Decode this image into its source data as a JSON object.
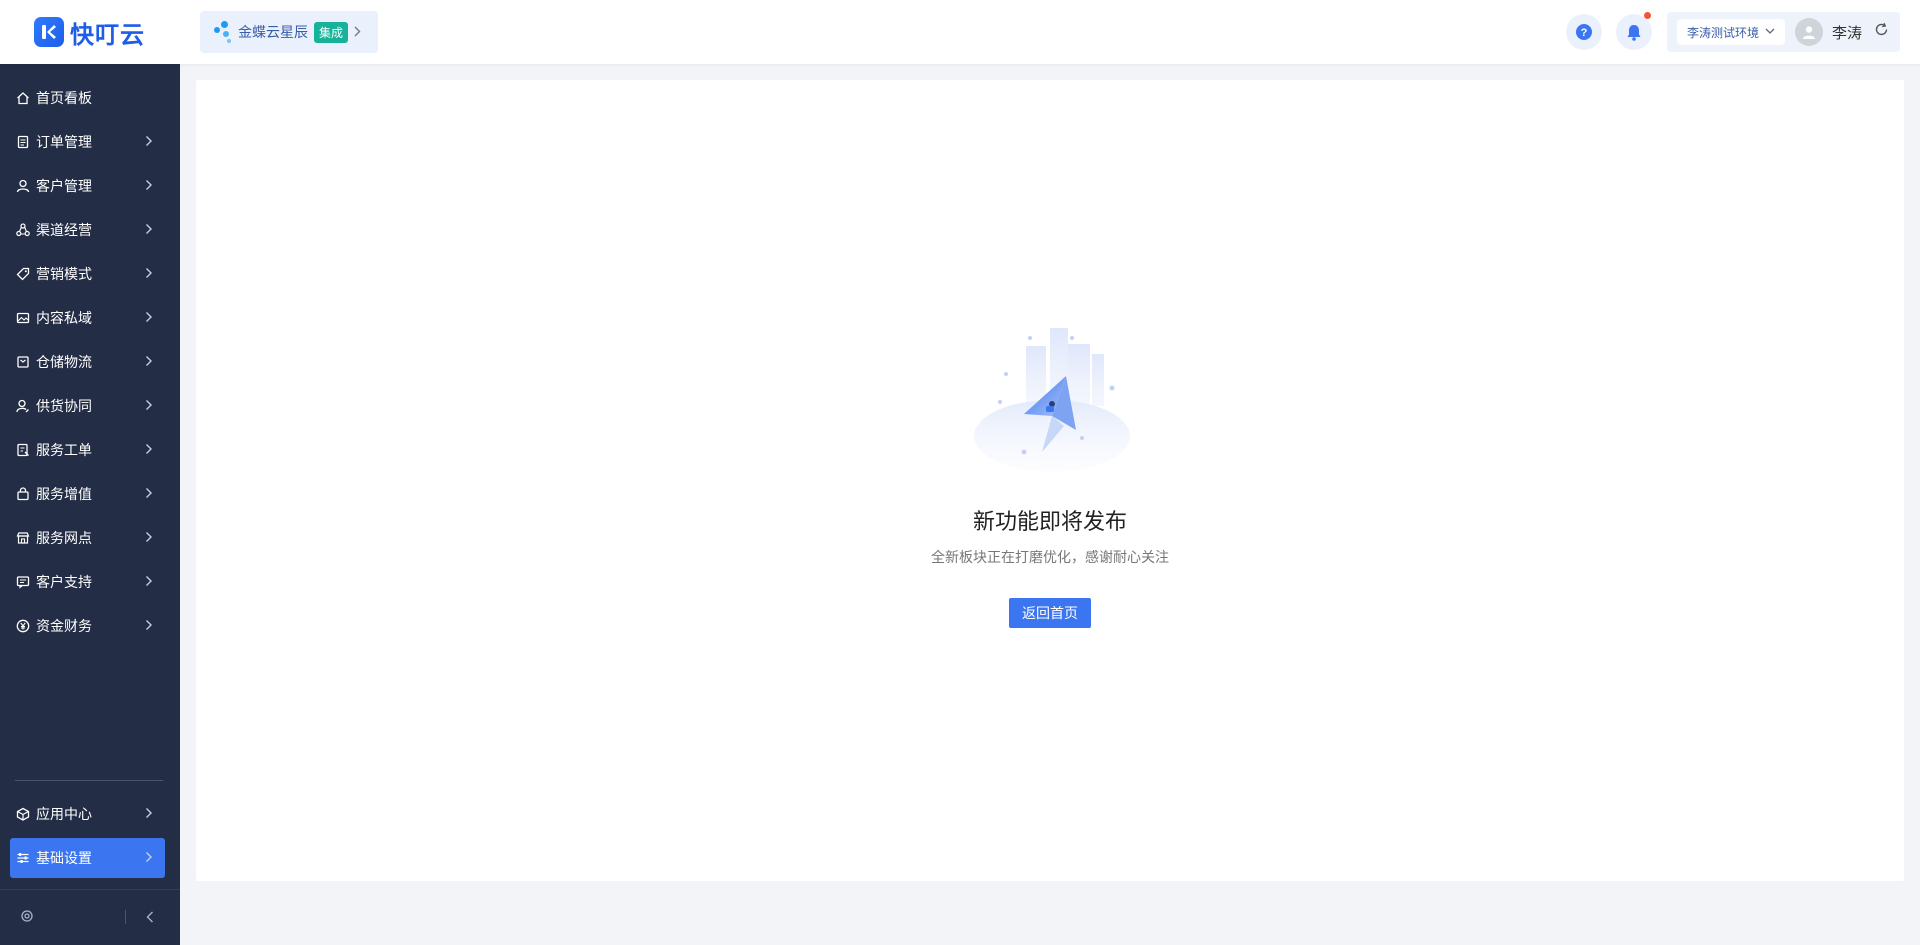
{
  "header": {
    "logo_text": "快叮云",
    "integration": {
      "label": "金蝶云星辰",
      "badge": "集成"
    },
    "help_icon": "question-circle-icon",
    "notification_icon": "bell-icon",
    "environment": "李涛测试环境",
    "username": "李涛"
  },
  "sidebar": {
    "items": [
      {
        "label": "首页看板",
        "icon": "home-icon"
      },
      {
        "label": "订单管理",
        "icon": "clipboard-icon"
      },
      {
        "label": "客户管理",
        "icon": "user-icon"
      },
      {
        "label": "渠道经营",
        "icon": "channel-icon"
      },
      {
        "label": "营销模式",
        "icon": "tag-icon"
      },
      {
        "label": "内容私域",
        "icon": "image-icon"
      },
      {
        "label": "仓储物流",
        "icon": "warehouse-icon"
      },
      {
        "label": "供货协同",
        "icon": "supplier-icon"
      },
      {
        "label": "服务工单",
        "icon": "ticket-icon"
      },
      {
        "label": "服务增值",
        "icon": "bag-icon"
      },
      {
        "label": "服务网点",
        "icon": "store-icon"
      },
      {
        "label": "客户支持",
        "icon": "support-icon"
      },
      {
        "label": "资金财务",
        "icon": "yen-icon"
      }
    ],
    "bottom_items": [
      {
        "label": "应用中心",
        "icon": "cube-icon"
      },
      {
        "label": "基础设置",
        "icon": "settings-sliders-icon",
        "active": true
      }
    ]
  },
  "main": {
    "empty_title": "新功能即将发布",
    "empty_subtitle": "全新板块正在打磨优化，感谢耐心关注",
    "home_button": "返回首页"
  },
  "colors": {
    "sidebar_bg": "#232d45",
    "accent": "#3b75f0",
    "badge_green": "#16b39a",
    "notification_dot": "#f5523a"
  }
}
